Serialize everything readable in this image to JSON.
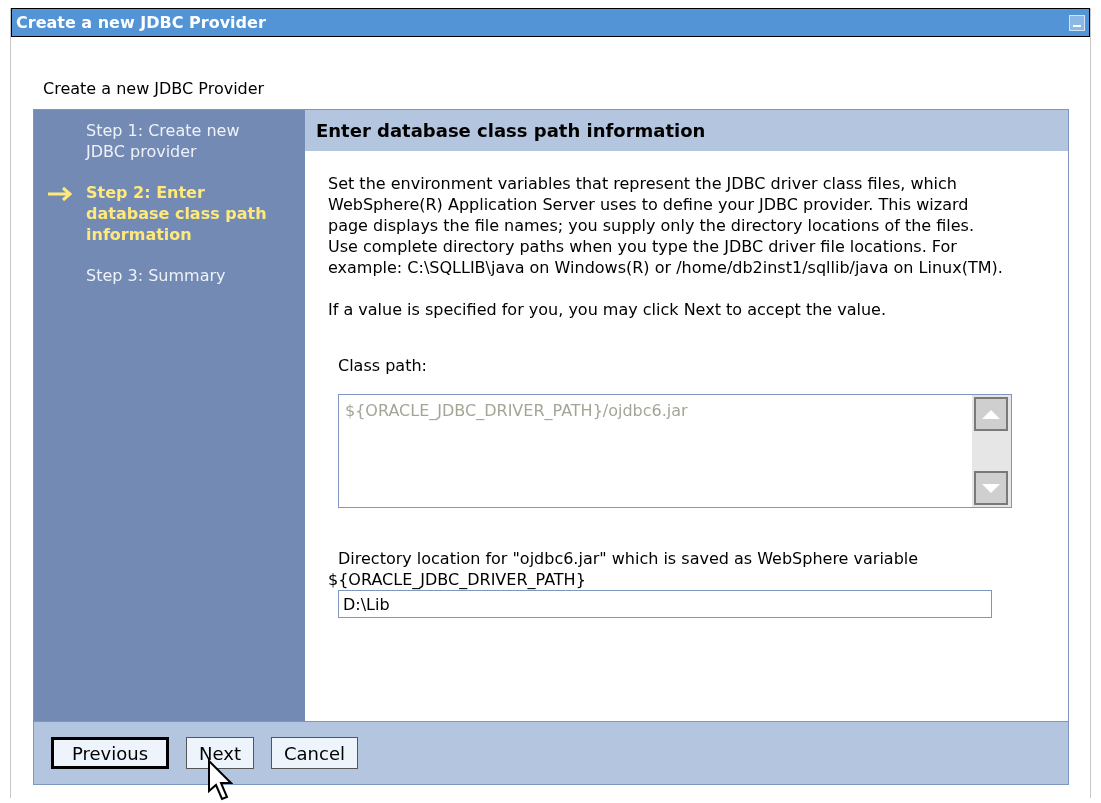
{
  "window": {
    "title": "Create a new JDBC Provider"
  },
  "page_title": "Create a new JDBC Provider",
  "steps": [
    {
      "label": "Step 1: Create new JDBC provider",
      "selected": false
    },
    {
      "label": "Step 2: Enter database class path information",
      "selected": true
    },
    {
      "label": "Step 3: Summary",
      "selected": false
    }
  ],
  "panel": {
    "heading": "Enter database class path information",
    "paragraphs": [
      "Set the environment variables that represent the JDBC driver class files, which WebSphere(R) Application Server uses to define your JDBC provider. This wizard page displays the file names; you supply only the directory locations of the files. Use complete directory paths when you type the JDBC driver file locations. For example: C:\\SQLLIB\\java on Windows(R) or /home/db2inst1/sqllib/java on Linux(TM).",
      "If a value is specified for you, you may click Next to accept the value."
    ],
    "class_path": {
      "label": "Class path:",
      "value": "${ORACLE_JDBC_DRIVER_PATH}/ojdbc6.jar",
      "disabled": true
    },
    "directory": {
      "label": "Directory location for \"ojdbc6.jar\" which is saved as WebSphere variable ${ORACLE_JDBC_DRIVER_PATH}",
      "value": "D:\\Lib"
    }
  },
  "buttons": [
    {
      "label": "Previous",
      "default": true
    },
    {
      "label": "Next",
      "default": false
    },
    {
      "label": "Cancel",
      "default": false
    }
  ]
}
